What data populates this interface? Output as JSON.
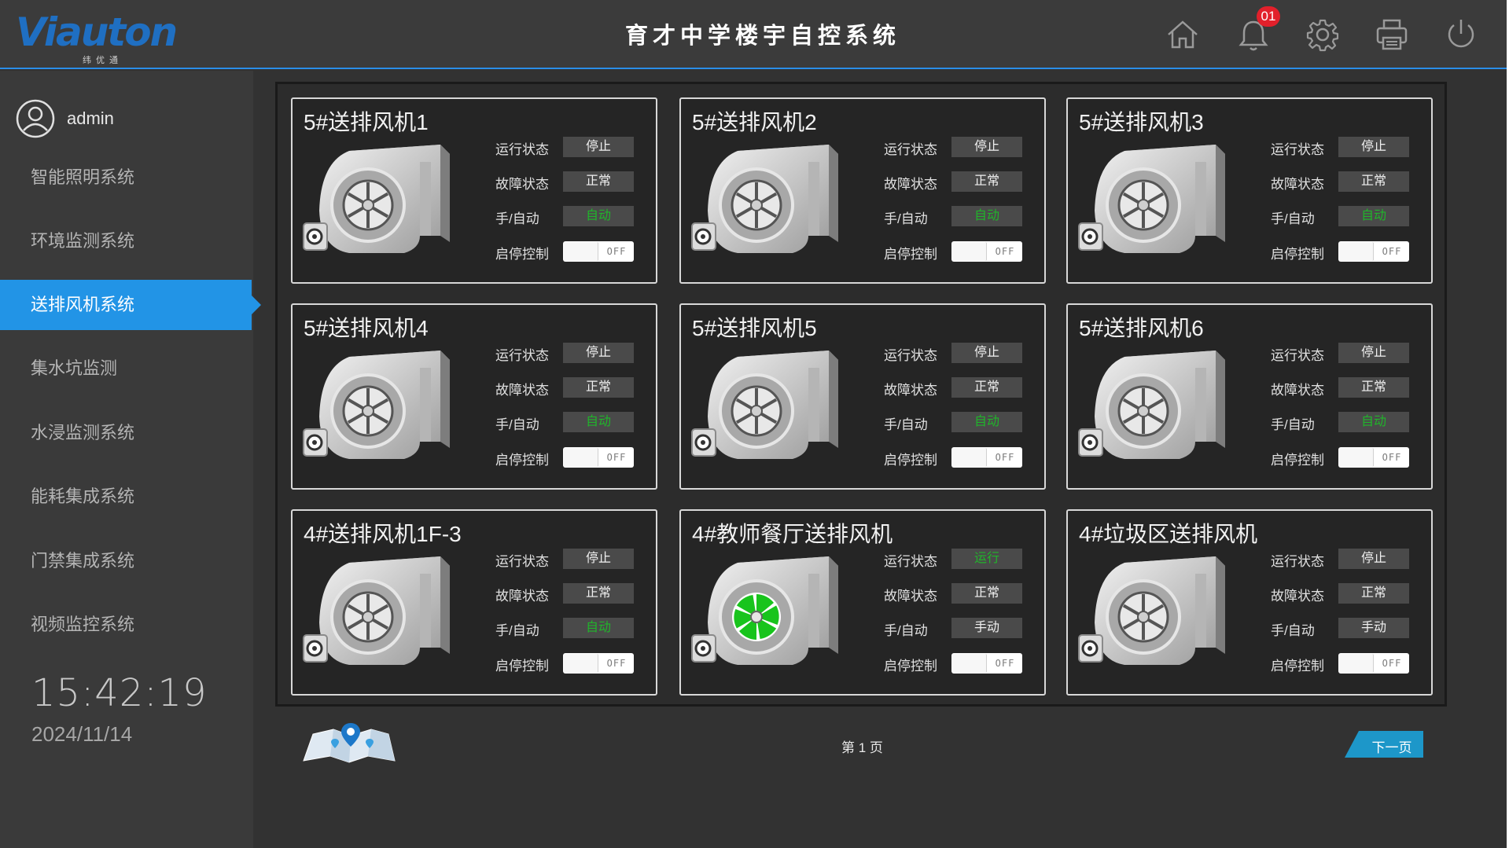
{
  "header": {
    "logo_text": "Viauton",
    "logo_sub": "纬优通",
    "title": "育才中学楼宇自控系统",
    "notification_count": "01",
    "icons": [
      "home-icon",
      "bell-icon",
      "gear-icon",
      "printer-icon",
      "power-icon"
    ]
  },
  "sidebar": {
    "user": "admin",
    "items": [
      {
        "label": "智能照明系统",
        "active": false
      },
      {
        "label": "环境监测系统",
        "active": false
      },
      {
        "label": "送排风机系统",
        "active": true
      },
      {
        "label": "集水坑监测",
        "active": false
      },
      {
        "label": "水浸监测系统",
        "active": false
      },
      {
        "label": "能耗集成系统",
        "active": false
      },
      {
        "label": "门禁集成系统",
        "active": false
      },
      {
        "label": "视频监控系统",
        "active": false
      }
    ],
    "time": "15:42:19",
    "date": "2024/11/14"
  },
  "labels": {
    "run": "运行状态",
    "fault": "故障状态",
    "mode": "手/自动",
    "control": "启停控制",
    "toggle_off": "OFF"
  },
  "fans": [
    {
      "name": "5#送排风机1",
      "run": "停止",
      "fault": "正常",
      "mode": "自动",
      "running": false
    },
    {
      "name": "5#送排风机2",
      "run": "停止",
      "fault": "正常",
      "mode": "自动",
      "running": false
    },
    {
      "name": "5#送排风机3",
      "run": "停止",
      "fault": "正常",
      "mode": "自动",
      "running": false
    },
    {
      "name": "5#送排风机4",
      "run": "停止",
      "fault": "正常",
      "mode": "自动",
      "running": false
    },
    {
      "name": "5#送排风机5",
      "run": "停止",
      "fault": "正常",
      "mode": "自动",
      "running": false
    },
    {
      "name": "5#送排风机6",
      "run": "停止",
      "fault": "正常",
      "mode": "自动",
      "running": false
    },
    {
      "name": "4#送排风机1F-3",
      "run": "停止",
      "fault": "正常",
      "mode": "自动",
      "running": false
    },
    {
      "name": "4#教师餐厅送排风机",
      "run": "运行",
      "fault": "正常",
      "mode": "手动",
      "running": true
    },
    {
      "name": "4#垃圾区送排风机",
      "run": "停止",
      "fault": "正常",
      "mode": "手动",
      "running": false
    }
  ],
  "pagination": {
    "page_label": "第 1 页",
    "next_label": "下一页"
  },
  "colors": {
    "accent": "#2294e6",
    "running_green": "#20b52a",
    "alert_red": "#e2202b"
  }
}
